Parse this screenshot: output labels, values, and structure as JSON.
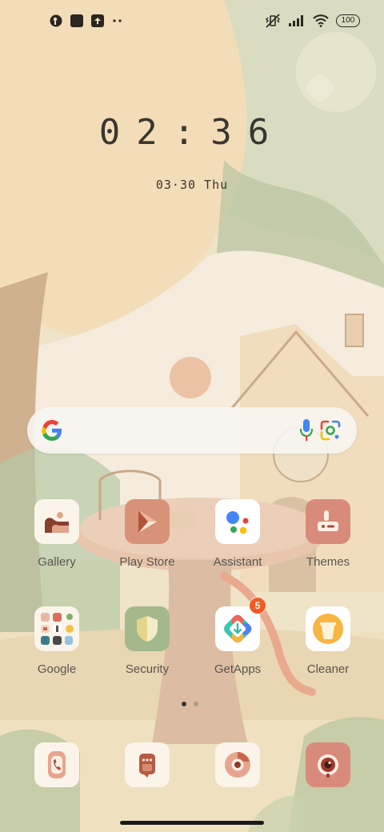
{
  "status_bar": {
    "battery": "100"
  },
  "lock": {
    "time": "02:36",
    "date": "03·30 Thu"
  },
  "search": {},
  "apps_row1": [
    {
      "label": "Gallery",
      "icon": "gallery-icon"
    },
    {
      "label": "Play Store",
      "icon": "play-store-icon"
    },
    {
      "label": "Assistant",
      "icon": "assistant-icon"
    },
    {
      "label": "Themes",
      "icon": "themes-icon"
    }
  ],
  "apps_row2": [
    {
      "label": "Google",
      "icon": "google-folder-icon"
    },
    {
      "label": "Security",
      "icon": "security-icon"
    },
    {
      "label": "GetApps",
      "icon": "getapps-icon",
      "badge": "5"
    },
    {
      "label": "Cleaner",
      "icon": "cleaner-icon"
    }
  ],
  "dock": [
    {
      "icon": "phone-icon"
    },
    {
      "icon": "messages-icon"
    },
    {
      "icon": "browser-icon"
    },
    {
      "icon": "camera-icon"
    }
  ],
  "page_indicator": {
    "pages": 2,
    "current": 1
  },
  "colors": {
    "accent": "#f25c24",
    "wallpaper_base": "#f0e2c6",
    "label": "#5a5550"
  }
}
